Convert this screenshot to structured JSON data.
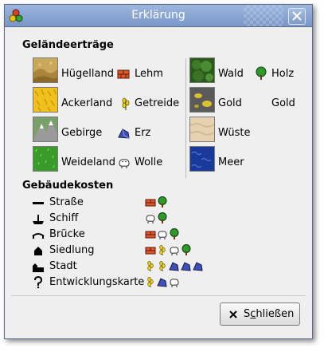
{
  "window": {
    "title": "Erklärung"
  },
  "terrain": {
    "heading": "Geländeerträge",
    "items": [
      {
        "terrain": "Hügelland",
        "resource": "Lehm",
        "resource_icon": "brick-icon"
      },
      {
        "terrain": "Ackerland",
        "resource": "Getreide",
        "resource_icon": "wheat-icon"
      },
      {
        "terrain": "Gebirge",
        "resource": "Erz",
        "resource_icon": "ore-icon"
      },
      {
        "terrain": "Weideland",
        "resource": "Wolle",
        "resource_icon": "wool-icon"
      },
      {
        "terrain": "Wald",
        "resource": "Holz",
        "resource_icon": "tree-icon"
      },
      {
        "terrain": "Gold",
        "resource": "Gold",
        "resource_icon": ""
      },
      {
        "terrain": "Wüste",
        "resource": "",
        "resource_icon": ""
      },
      {
        "terrain": "Meer",
        "resource": "",
        "resource_icon": ""
      }
    ]
  },
  "buildings": {
    "heading": "Gebäudekosten",
    "items": [
      {
        "name": "Straße",
        "cost": [
          "brick",
          "lumber"
        ]
      },
      {
        "name": "Schiff",
        "cost": [
          "wool",
          "lumber"
        ]
      },
      {
        "name": "Brücke",
        "cost": [
          "brick",
          "wool",
          "lumber"
        ]
      },
      {
        "name": "Siedlung",
        "cost": [
          "brick",
          "grain",
          "wool",
          "lumber"
        ]
      },
      {
        "name": "Stadt",
        "cost": [
          "grain",
          "grain",
          "ore",
          "ore",
          "ore"
        ]
      },
      {
        "name": "Entwicklungskarte",
        "cost": [
          "grain",
          "ore",
          "wool"
        ]
      }
    ]
  },
  "footer": {
    "close_label": "Schließen",
    "close_mnemonic": "c"
  },
  "colors": {
    "titlebar": "#8aa6d4",
    "window_bg": "#efefef",
    "brick": "#e0572a",
    "lumber": "#2f9a2a",
    "grain": "#e8c20c",
    "ore": "#3f4fb8",
    "wool": "#ffffff"
  }
}
